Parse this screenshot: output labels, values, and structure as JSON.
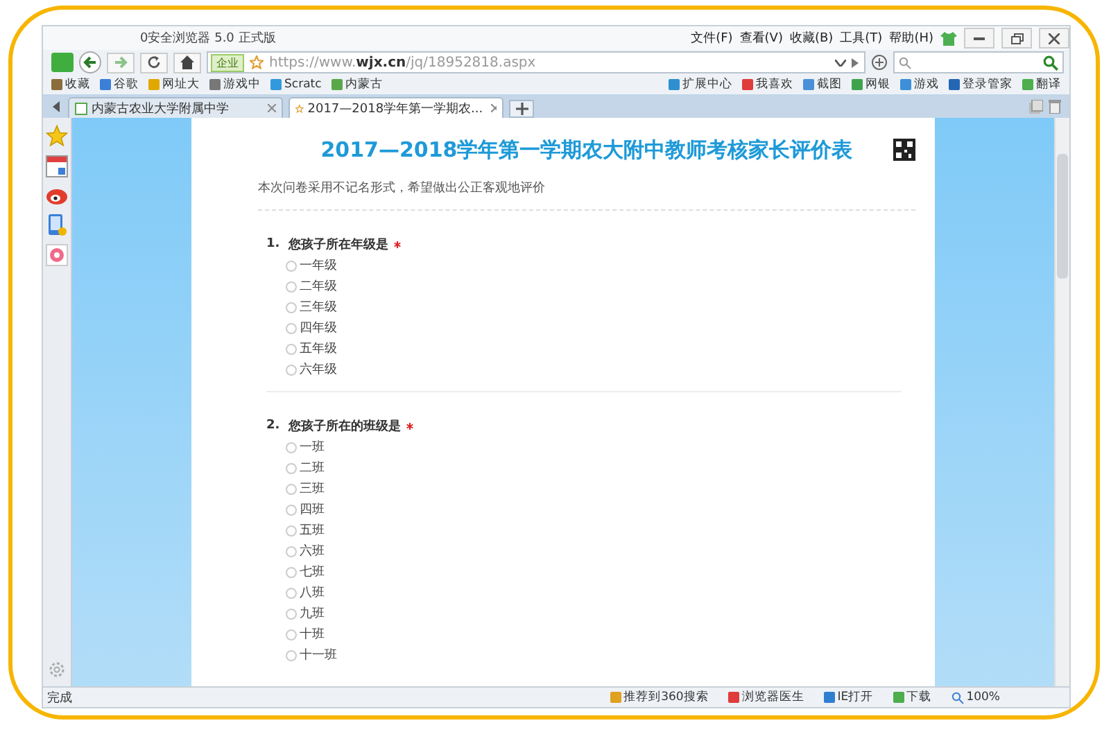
{
  "window": {
    "title": "0安全浏览器 5.0 正式版",
    "menu": [
      "文件(F)",
      "查看(V)",
      "收藏(B)",
      "工具(T)",
      "帮助(H)"
    ]
  },
  "toolbar": {
    "badge": "企业",
    "address": "https://www.**wjx.cn**/jq/18952818.aspx"
  },
  "bookmarks_left": [
    {
      "label": "收藏",
      "color": "#8a6d3b"
    },
    {
      "label": "谷歌",
      "color": "#3b7fd8"
    },
    {
      "label": "网址大",
      "color": "#e0a800"
    },
    {
      "label": "游戏中",
      "color": "#777777"
    },
    {
      "label": "Scratc",
      "color": "#3399dd"
    },
    {
      "label": "内蒙古",
      "color": "#5aa84a"
    }
  ],
  "bookmarks_right": [
    {
      "label": "扩展中心",
      "color": "#2f8fd0"
    },
    {
      "label": "我喜欢",
      "color": "#e03c3c"
    },
    {
      "label": "截图",
      "color": "#4a90d9"
    },
    {
      "label": "网银",
      "color": "#3fa34d"
    },
    {
      "label": "游戏",
      "color": "#3c8fd8"
    },
    {
      "label": "登录管家",
      "color": "#2467b4"
    },
    {
      "label": "翻译",
      "color": "#4cae4c"
    }
  ],
  "tabs": [
    {
      "label": "内蒙古农业大学附属中学",
      "selected": false
    },
    {
      "label": "2017—2018学年第一学期农...",
      "selected": true
    }
  ],
  "survey": {
    "title": "2017—2018学年第一学期农大附中教师考核家长评价表",
    "intro": "本次问卷采用不记名形式，希望做出公正客观地评价",
    "questions": [
      {
        "number": "1.",
        "text": "您孩子所在年级是",
        "required": true,
        "options": [
          {
            "label": "一年级",
            "selected": false
          },
          {
            "label": "二年级",
            "selected": false
          },
          {
            "label": "三年级",
            "selected": false
          },
          {
            "label": "四年级",
            "selected": false
          },
          {
            "label": "五年级",
            "selected": false
          },
          {
            "label": "六年级",
            "selected": false
          }
        ]
      },
      {
        "number": "2.",
        "text": "您孩子所在的班级是",
        "required": true,
        "options": [
          {
            "label": "一班",
            "selected": false
          },
          {
            "label": "二班",
            "selected": false
          },
          {
            "label": "三班",
            "selected": false
          },
          {
            "label": "四班",
            "selected": false
          },
          {
            "label": "五班",
            "selected": false
          },
          {
            "label": "六班",
            "selected": false
          },
          {
            "label": "七班",
            "selected": false
          },
          {
            "label": "八班",
            "selected": false
          },
          {
            "label": "九班",
            "selected": false
          },
          {
            "label": "十班",
            "selected": false
          },
          {
            "label": "十一班",
            "selected": false
          }
        ]
      }
    ]
  },
  "status_bar": {
    "text": "完成",
    "items": [
      {
        "label": "推荐到360搜索",
        "color": "#e0a020"
      },
      {
        "label": "浏览器医生",
        "color": "#e03c3c"
      },
      {
        "label": "IE打开",
        "color": "#2f7fd0"
      },
      {
        "label": "下载",
        "color": "#4cae4c"
      }
    ],
    "zoom": "100%"
  }
}
